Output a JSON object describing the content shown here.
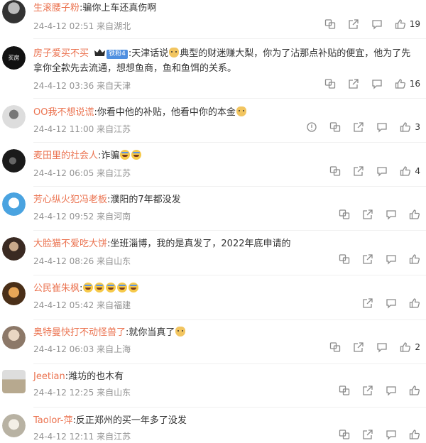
{
  "comments": [
    {
      "user": "生滚腰子粉",
      "text": "骗你上车还真伤啊",
      "time": "24-4-12 02:51",
      "location": "来自湖北",
      "likes": "19",
      "report": false,
      "share": true,
      "translate": true
    },
    {
      "user": "房子爱买不买",
      "badge": "铁粉4",
      "text": "天津话说",
      "text2": "典型的财迷赚大梨，你为了沾那点补贴的便宜，他为了先拿你全款先去流通，想想鱼商，鱼和鱼饵的关系。",
      "time": "24-4-12 03:36",
      "location": "来自天津",
      "likes": "16",
      "report": false,
      "share": true,
      "translate": true
    },
    {
      "user": "OO我不想说谎",
      "text": "你看中他的补贴，他看中你的本金",
      "time": "24-4-12 11:00",
      "location": "来自江苏",
      "likes": "3",
      "report": true,
      "share": true,
      "translate": true
    },
    {
      "user": "麦田里的社会人",
      "text": "诈骗",
      "time": "24-4-12 06:05",
      "location": "来自江苏",
      "likes": "4",
      "report": false,
      "share": true,
      "translate": true
    },
    {
      "user": "芳心纵火犯冯老板",
      "text": "濮阳的7年都没发",
      "time": "24-4-12 09:52",
      "location": "来自河南",
      "likes": "",
      "report": false,
      "share": true,
      "translate": true
    },
    {
      "user": "大脸猫不爱吃大饼",
      "text": "坐班淄博，我的是真发了，2022年底申请的",
      "time": "24-4-12 08:26",
      "location": "来自山东",
      "likes": "",
      "report": false,
      "share": true,
      "translate": true
    },
    {
      "user": "公民崔朱枫",
      "text": "",
      "time": "24-4-12 05:42",
      "location": "来自福建",
      "likes": "",
      "report": false,
      "share": true,
      "translate": false
    },
    {
      "user": "奥特曼快打不动怪兽了",
      "text": "就你当真了",
      "time": "24-4-12 06:03",
      "location": "来自上海",
      "likes": "2",
      "report": false,
      "share": true,
      "translate": true
    },
    {
      "user": "Jeetian",
      "text": "潍坊的也木有",
      "time": "24-4-12 12:25",
      "location": "来自山东",
      "likes": "",
      "report": false,
      "share": true,
      "translate": true
    },
    {
      "user": "Taolor-萍",
      "text": "反正郑州的买一年多了没发",
      "time": "24-4-12 12:11",
      "location": "来自江苏",
      "likes": "",
      "report": false,
      "share": true,
      "translate": true
    }
  ],
  "colors": {
    "username": "#eb7350",
    "meta": "#939393",
    "icon": "#8a8a8a"
  },
  "icons": [
    "report-icon",
    "translate-icon",
    "share-icon",
    "comment-icon",
    "like-icon"
  ]
}
